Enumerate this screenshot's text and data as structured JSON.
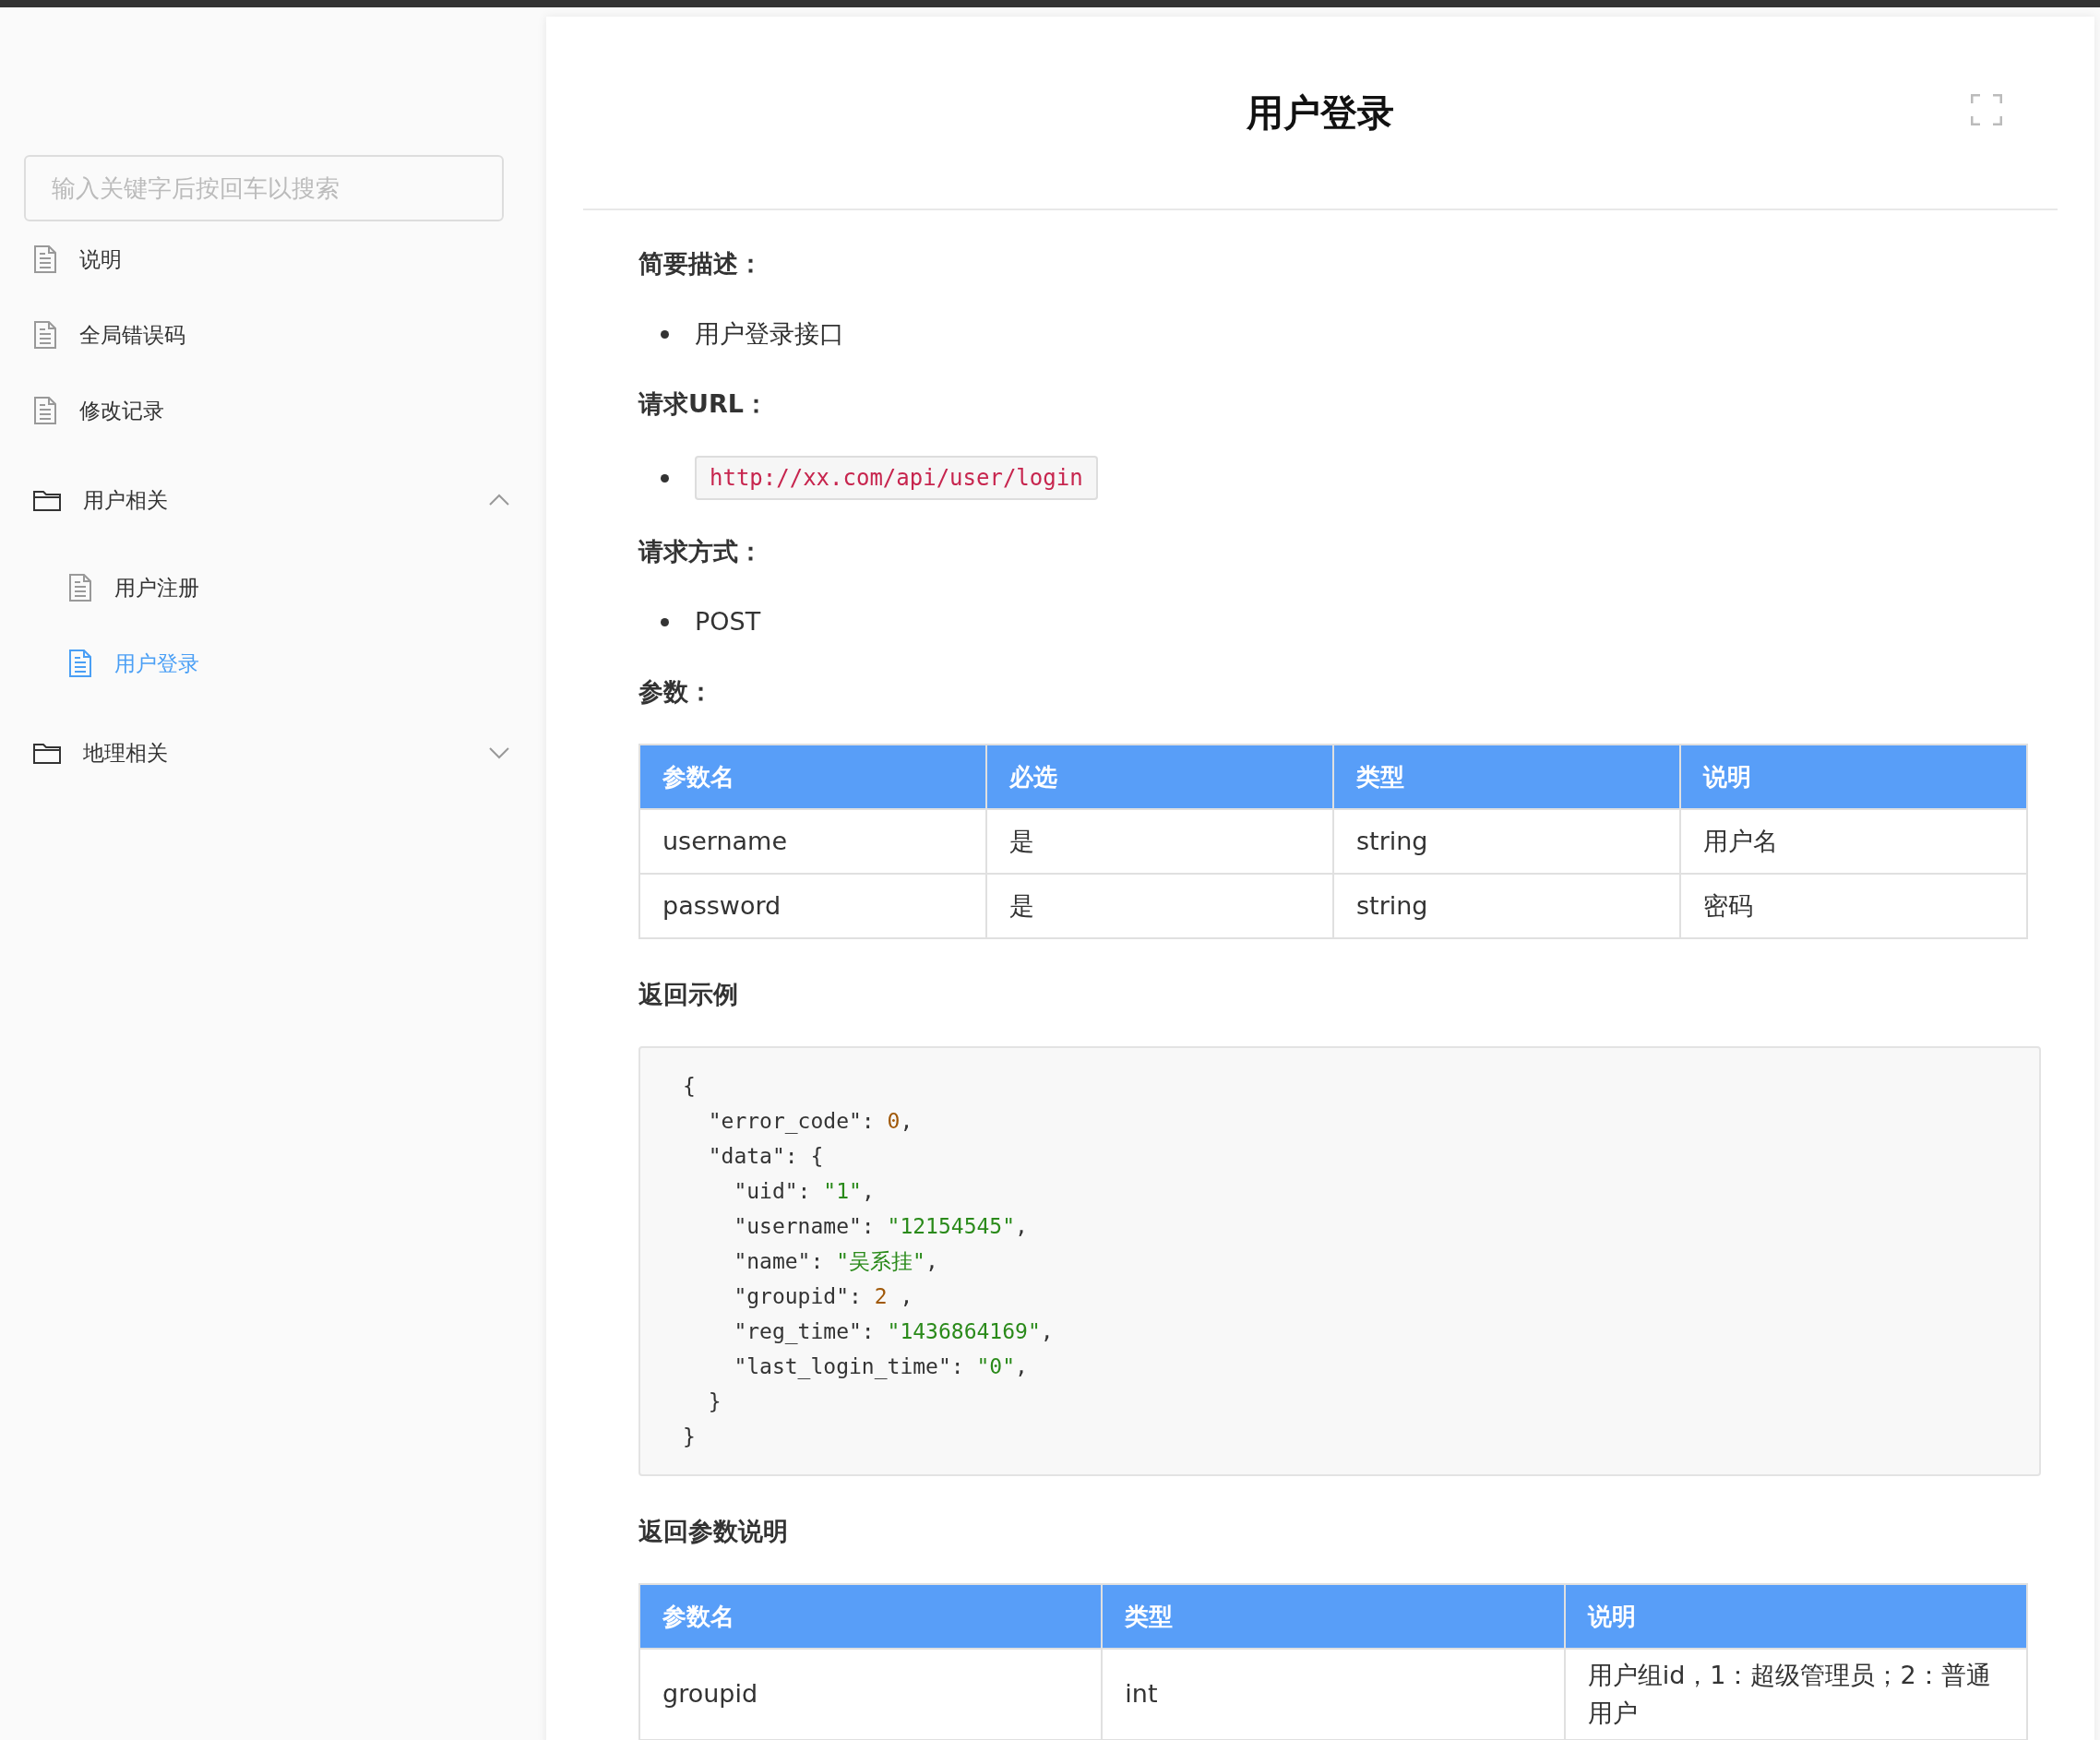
{
  "sidebar": {
    "search": {
      "placeholder": "输入关键字后按回车以搜索"
    },
    "items": [
      {
        "kind": "doc",
        "label": "说明",
        "selected": false
      },
      {
        "kind": "doc",
        "label": "全局错误码",
        "selected": false
      },
      {
        "kind": "doc",
        "label": "修改记录",
        "selected": false
      },
      {
        "kind": "folder",
        "label": "用户相关",
        "expanded": true,
        "children": [
          {
            "kind": "doc",
            "label": "用户注册",
            "selected": false
          },
          {
            "kind": "doc",
            "label": "用户登录",
            "selected": true
          }
        ]
      },
      {
        "kind": "folder",
        "label": "地理相关",
        "expanded": false
      }
    ]
  },
  "page": {
    "title": "用户登录",
    "sections": [
      {
        "kind": "heading",
        "text": "简要描述："
      },
      {
        "kind": "bullet",
        "text": "用户登录接口"
      },
      {
        "kind": "heading",
        "text": "请求URL："
      },
      {
        "kind": "code_bullet",
        "text": "http://xx.com/api/user/login"
      },
      {
        "kind": "heading",
        "text": "请求方式："
      },
      {
        "kind": "bullet",
        "text": "POST"
      },
      {
        "kind": "heading",
        "text": "参数："
      },
      {
        "kind": "table",
        "columns": [
          "参数名",
          "必选",
          "类型",
          "说明"
        ],
        "rows": [
          [
            "username",
            "是",
            "string",
            "用户名"
          ],
          [
            "password",
            "是",
            "string",
            "密码"
          ]
        ]
      },
      {
        "kind": "heading",
        "text": "返回示例"
      },
      {
        "kind": "code",
        "lines": [
          [
            {
              "kind": "plain",
              "text": "{"
            }
          ],
          [
            {
              "kind": "plain",
              "text": "  \"error_code\": "
            },
            {
              "kind": "number",
              "text": "0"
            },
            {
              "kind": "plain",
              "text": ","
            }
          ],
          [
            {
              "kind": "plain",
              "text": "  \"data\": {"
            }
          ],
          [
            {
              "kind": "plain",
              "text": "    \"uid\": "
            },
            {
              "kind": "string",
              "text": "\"1\""
            },
            {
              "kind": "plain",
              "text": ","
            }
          ],
          [
            {
              "kind": "plain",
              "text": "    \"username\": "
            },
            {
              "kind": "string",
              "text": "\"12154545\""
            },
            {
              "kind": "plain",
              "text": ","
            }
          ],
          [
            {
              "kind": "plain",
              "text": "    \"name\": "
            },
            {
              "kind": "string",
              "text": "\"吴系挂\""
            },
            {
              "kind": "plain",
              "text": ","
            }
          ],
          [
            {
              "kind": "plain",
              "text": "    \"groupid\": "
            },
            {
              "kind": "number",
              "text": "2"
            },
            {
              "kind": "plain",
              "text": " ,"
            }
          ],
          [
            {
              "kind": "plain",
              "text": "    \"reg_time\": "
            },
            {
              "kind": "string",
              "text": "\"1436864169\""
            },
            {
              "kind": "plain",
              "text": ","
            }
          ],
          [
            {
              "kind": "plain",
              "text": "    \"last_login_time\": "
            },
            {
              "kind": "string",
              "text": "\"0\""
            },
            {
              "kind": "plain",
              "text": ","
            }
          ],
          [
            {
              "kind": "plain",
              "text": "  }"
            }
          ],
          [
            {
              "kind": "plain",
              "text": "}"
            }
          ]
        ]
      },
      {
        "kind": "heading",
        "text": "返回参数说明"
      },
      {
        "kind": "table",
        "columns": [
          "参数名",
          "类型",
          "说明"
        ],
        "rows": [
          [
            "groupid",
            "int",
            "用户组id，1：超级管理员；2：普通用户"
          ]
        ]
      }
    ]
  }
}
